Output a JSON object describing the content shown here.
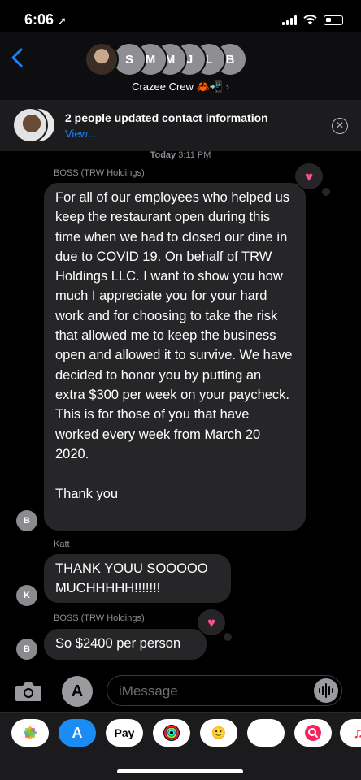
{
  "status": {
    "time": "6:06"
  },
  "header": {
    "group_name": "Crazee Crew",
    "group_emojis": "🦀📲",
    "member_initials": [
      "S",
      "M",
      "M",
      "J",
      "L",
      "B"
    ]
  },
  "banner": {
    "title": "2 people updated contact information",
    "link": "View..."
  },
  "chat": {
    "timestamp_day": "Today",
    "timestamp_time": "3:11 PM",
    "messages": [
      {
        "sender": "BOSS (TRW Holdings)",
        "avatar_initial": "B",
        "text": "For all of our employees who helped us keep the restaurant open during this time when we had to closed our dine in due to COVID 19. On behalf of TRW Holdings LLC. I want to show you how much I appreciate you for your hard work and for choosing to take the  risk that allowed me to keep the business open and allowed it to survive. We have decided to honor you by putting an extra $300 per week on your paycheck. This is for those of you that have worked every week from March 20 2020.",
        "text2": "Thank you",
        "tapback": "heart"
      },
      {
        "sender": "Katt",
        "avatar_initial": "K",
        "text": "THANK YOUU SOOOOO MUCHHHHH!!!!!!!"
      },
      {
        "sender": "BOSS (TRW Holdings)",
        "avatar_initial": "B",
        "text": "So $2400 per person",
        "tapback": "heart"
      }
    ]
  },
  "compose": {
    "placeholder": "iMessage"
  },
  "drawer": {
    "apps": [
      "photos-icon",
      "app-store-icon",
      "apple-pay-icon",
      "activity-icon",
      "memoji-icon",
      "animoji-icon",
      "search-images-icon",
      "music-icon"
    ],
    "apple_pay_label": "Pay"
  },
  "colors": {
    "bubble": "#262628",
    "accent": "#1a82ff",
    "heart": "#ff4d8b",
    "background": "#000000"
  }
}
